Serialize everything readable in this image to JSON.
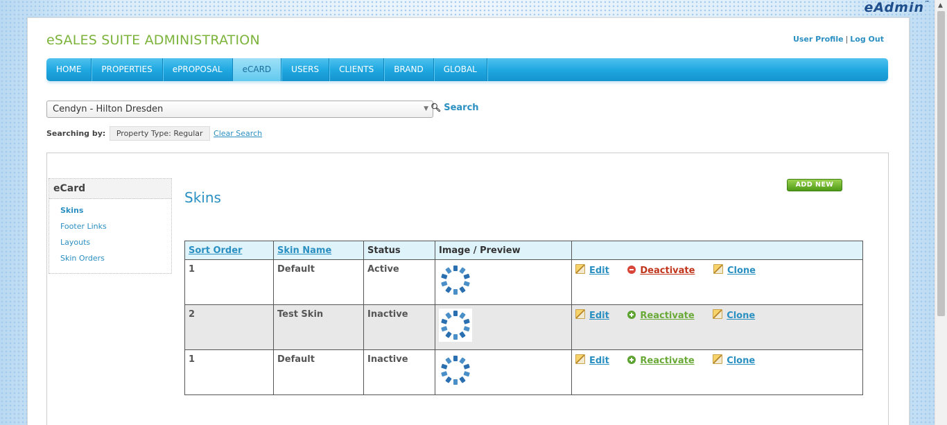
{
  "brand": {
    "logo_text": "eAdmin",
    "tm": "™"
  },
  "app": {
    "title": "eSALES SUITE ADMINISTRATION"
  },
  "user_links": {
    "profile": "User Profile",
    "sep": "|",
    "logout": "Log Out"
  },
  "nav": {
    "items": [
      "HOME",
      "PROPERTIES",
      "ePROPOSAL",
      "eCARD",
      "USERS",
      "CLIENTS",
      "BRAND",
      "GLOBAL"
    ],
    "active": "eCARD"
  },
  "property_select": {
    "value": "Cendyn - Hilton Dresden"
  },
  "search": {
    "label": "Search"
  },
  "searching_by": {
    "label": "Searching by:",
    "filter": "Property Type: Regular",
    "clear": "Clear Search"
  },
  "sidebar": {
    "title": "eCard",
    "items": [
      "Skins",
      "Footer Links",
      "Layouts",
      "Skin Orders"
    ],
    "active": "Skins"
  },
  "section": {
    "title": "Skins",
    "add_new": "ADD NEW"
  },
  "table": {
    "headers": [
      "Sort Order",
      "Skin Name",
      "Status",
      "Image / Preview",
      ""
    ],
    "rows": [
      {
        "sort_order": "1",
        "skin_name": "Default",
        "status": "Active",
        "actions": [
          "Edit",
          "Deactivate",
          "Clone"
        ]
      },
      {
        "sort_order": "2",
        "skin_name": "Test Skin",
        "status": "Inactive",
        "actions": [
          "Edit",
          "Reactivate",
          "Clone"
        ]
      },
      {
        "sort_order": "1",
        "skin_name": "Default",
        "status": "Inactive",
        "actions": [
          "Edit",
          "Reactivate",
          "Clone"
        ]
      }
    ]
  },
  "colors": {
    "accent": "#2a8fc1",
    "title_green": "#7bb33b",
    "nav_blue": "#20a8e1",
    "deactivate_red": "#c0351c",
    "reactivate_green": "#69a937"
  },
  "icons": {
    "search": "magnifier-icon",
    "edit": "pencil-icon",
    "deactivate": "minus-circle-icon",
    "reactivate": "plus-circle-icon",
    "clone": "pencil-icon",
    "preview": "spinner-ring-icon"
  }
}
